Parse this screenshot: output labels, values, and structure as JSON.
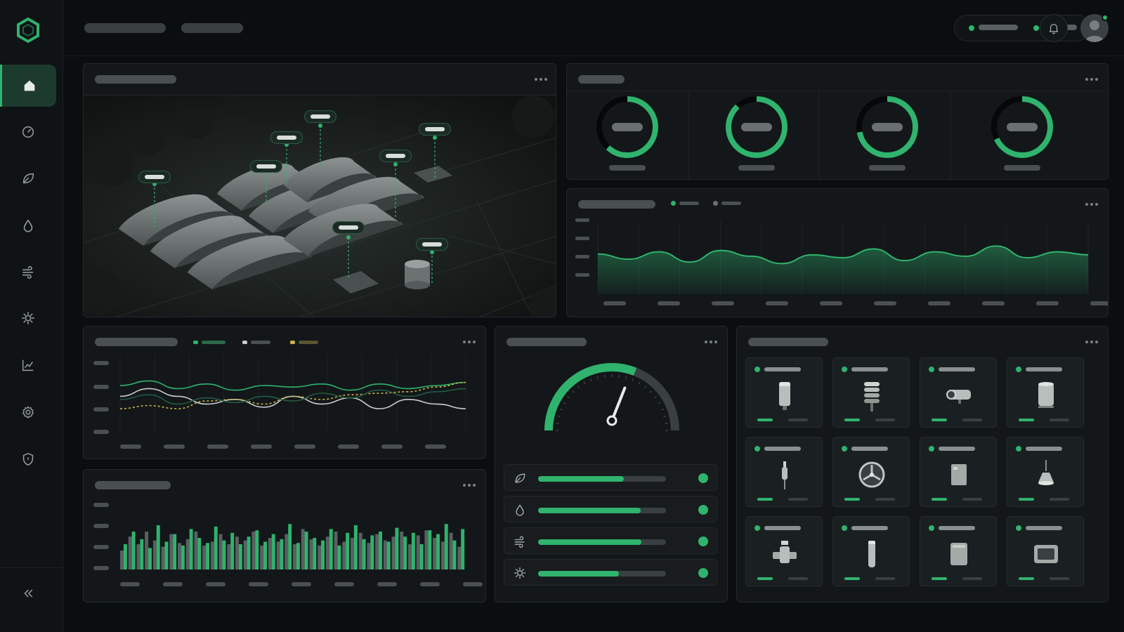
{
  "colors": {
    "accent": "#2fb36d",
    "panel": "#131719",
    "background": "#0b0e10"
  },
  "sidebar": {
    "logo_icon": "hexagon-logo-icon",
    "items": [
      {
        "id": "home",
        "icon": "home-icon",
        "active": true
      },
      {
        "id": "dashboard",
        "icon": "speedometer-icon"
      },
      {
        "id": "crops",
        "icon": "leaf-icon"
      },
      {
        "id": "water",
        "icon": "droplet-icon"
      },
      {
        "id": "wind",
        "icon": "wind-icon"
      },
      {
        "id": "light",
        "icon": "sun-icon"
      },
      {
        "id": "analytics",
        "icon": "line-chart-icon"
      },
      {
        "id": "settings",
        "icon": "gear-icon"
      },
      {
        "id": "security",
        "icon": "shield-icon"
      }
    ],
    "collapse_icon": "double-chevron-left-icon"
  },
  "header": {
    "notification_icon": "bell-icon",
    "avatar_icon": "user-avatar-icon"
  },
  "kpis": [
    {
      "progress": 0.62
    },
    {
      "progress": 0.88
    },
    {
      "progress": 0.72
    },
    {
      "progress": 0.68
    }
  ],
  "trend_area": {
    "values": [
      55,
      48,
      58,
      44,
      60,
      52,
      42,
      54,
      50,
      62,
      46,
      58,
      52,
      66,
      50,
      58,
      54
    ]
  },
  "multi_line": {
    "series": [
      {
        "color": "#2fb36d",
        "values": [
          60,
          66,
          56,
          62,
          54,
          60,
          58,
          62,
          54,
          62,
          56,
          60,
          64
        ]
      },
      {
        "color": "#c8cdca",
        "values": [
          46,
          56,
          46,
          36,
          42,
          32,
          46,
          36,
          44,
          30,
          42,
          36,
          30
        ]
      },
      {
        "color": "#c9b24a",
        "values": [
          30,
          34,
          30,
          40,
          42,
          36,
          46,
          42,
          48,
          50,
          52,
          58,
          64
        ]
      },
      {
        "color": "#245a41",
        "values": [
          42,
          48,
          36,
          44,
          38,
          46,
          40,
          50,
          44,
          54,
          46,
          52,
          56
        ]
      }
    ]
  },
  "bar_chart": {
    "green": [
      40,
      60,
      48,
      34,
      70,
      44,
      56,
      38,
      64,
      50,
      42,
      68,
      46,
      58,
      40,
      52,
      62,
      44,
      56,
      48,
      72,
      42,
      60,
      50,
      46,
      64,
      38,
      58,
      70,
      48,
      54,
      60,
      44,
      66,
      52,
      58,
      40,
      62,
      56,
      72,
      46,
      64
    ],
    "gray": [
      30,
      52,
      40,
      60,
      46,
      36,
      56,
      42,
      48,
      60,
      38,
      44,
      56,
      40,
      52,
      46,
      60,
      38,
      50,
      44,
      56,
      40,
      64,
      48,
      38,
      52,
      60,
      44,
      50,
      58,
      42,
      56,
      46,
      52,
      60,
      40,
      54,
      62,
      50,
      44,
      58,
      36
    ]
  },
  "gauge": {
    "value": 0.62,
    "rows": [
      {
        "icon": "leaf-icon",
        "value": 0.67
      },
      {
        "icon": "droplet-icon",
        "value": 0.8
      },
      {
        "icon": "wind-icon",
        "value": 0.81
      },
      {
        "icon": "sun-icon",
        "value": 0.63
      }
    ]
  },
  "devices": [
    {
      "icon": "cylinder-sensor-icon"
    },
    {
      "icon": "weather-station-icon"
    },
    {
      "icon": "camera-icon"
    },
    {
      "icon": "canister-icon"
    },
    {
      "icon": "probe-icon"
    },
    {
      "icon": "fan-icon"
    },
    {
      "icon": "control-box-icon"
    },
    {
      "icon": "lamp-icon"
    },
    {
      "icon": "valve-icon"
    },
    {
      "icon": "tube-sensor-icon"
    },
    {
      "icon": "panel-box-icon"
    },
    {
      "icon": "display-unit-icon"
    }
  ]
}
